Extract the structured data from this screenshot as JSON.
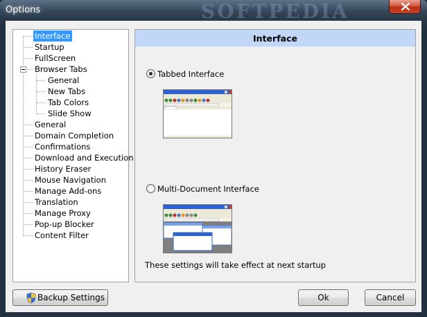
{
  "window": {
    "title": "Options",
    "watermark": "SOFTPEDIA"
  },
  "tree": {
    "items": [
      {
        "label": "Interface",
        "selected": true
      },
      {
        "label": "Startup"
      },
      {
        "label": "FullScreen"
      },
      {
        "label": "Browser Tabs",
        "expanded": true
      },
      {
        "label": "General"
      },
      {
        "label": "New Tabs"
      },
      {
        "label": "Tab Colors"
      },
      {
        "label": "Slide Show"
      },
      {
        "label": "General"
      },
      {
        "label": "Domain Completion"
      },
      {
        "label": "Confirmations"
      },
      {
        "label": "Download and Execution"
      },
      {
        "label": "History Eraser"
      },
      {
        "label": "Mouse Navigation"
      },
      {
        "label": "Manage Add-ons"
      },
      {
        "label": "Translation"
      },
      {
        "label": "Manage Proxy"
      },
      {
        "label": "Pop-up Blocker"
      },
      {
        "label": "Content Filter"
      }
    ]
  },
  "panel": {
    "header": "Interface",
    "options": [
      {
        "label": "Tabbed Interface",
        "checked": true
      },
      {
        "label": "Multi-Document Interface",
        "checked": false
      }
    ],
    "note": "These settings will take effect at next startup"
  },
  "buttons": {
    "backup": "Backup Settings",
    "ok": "Ok",
    "cancel": "Cancel"
  },
  "colors": {
    "selection": "#3399ff",
    "header_bg": "#c2d6f8",
    "titlebar": "#34475a",
    "close": "#c9462a"
  }
}
